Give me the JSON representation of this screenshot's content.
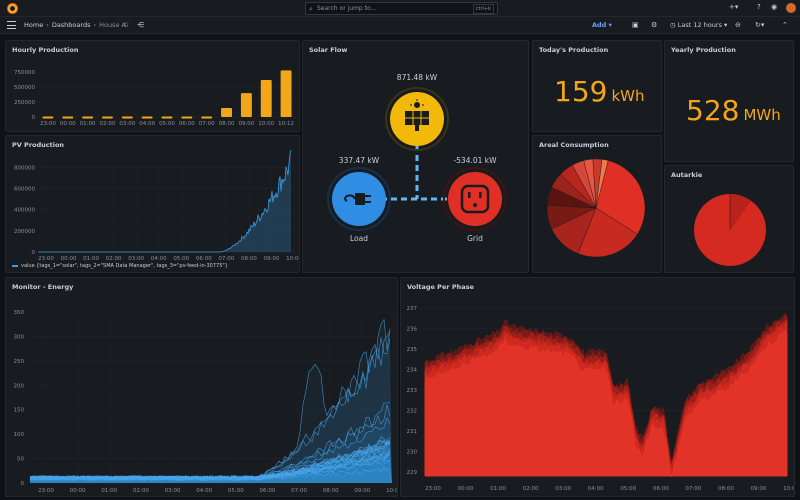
{
  "topbar": {
    "search_placeholder": "Search or jump to...",
    "search_shortcut": "ctrl+k",
    "plus_icon": "plus-icon",
    "news_icon": "rss-icon"
  },
  "nav": {
    "breadcrumb": [
      "Home",
      "Dashboards",
      "House A"
    ],
    "add_label": "Add",
    "time_range": "Last 12 hours"
  },
  "colors": {
    "accent": "#f2a71b",
    "blue": "#3d9be3",
    "red": "#e02f25",
    "panel_bg": "#181b1f"
  },
  "panels": {
    "hourly": {
      "title": "Hourly Production",
      "y_ticks": [
        "750000",
        "500000",
        "250000",
        "0"
      ],
      "x_ticks": [
        "23:00",
        "00:00",
        "01:00",
        "02:00",
        "03:00",
        "04:00",
        "05:00",
        "06:00",
        "07:00",
        "08:00",
        "09:00",
        "10:00",
        "10:12"
      ],
      "values": [
        8000,
        8000,
        8000,
        8000,
        8000,
        8000,
        8000,
        8000,
        8000,
        150000,
        400000,
        620000,
        780000
      ]
    },
    "pv": {
      "title": "PV Production",
      "y_ticks": [
        "800000",
        "600000",
        "400000",
        "200000",
        "0"
      ],
      "x_ticks": [
        "23:00",
        "00:00",
        "01:00",
        "02:00",
        "03:00",
        "04:00",
        "05:00",
        "06:00",
        "07:00",
        "08:00",
        "09:00",
        "10:00"
      ],
      "legend": "value {tags_1=\"solar\", tags_2=\"SMA Data Manager\", tags_3=\"pv-feed-in-30775\"}"
    },
    "solar_flow": {
      "title": "Solar Flow",
      "solar_value": "871.48 kW",
      "load_value": "337.47 kW",
      "grid_value": "-534.01 kW",
      "load_label": "Load",
      "grid_label": "Grid"
    },
    "today": {
      "title": "Today's Production",
      "value": "159",
      "unit": "kWh"
    },
    "yearly": {
      "title": "Yearly Production",
      "value": "528",
      "unit": "MWh"
    },
    "areal": {
      "title": "Areal Consumption"
    },
    "autarkie": {
      "title": "Autarkie"
    },
    "monitor": {
      "title": "Monitor - Energy",
      "y_ticks": [
        "350",
        "300",
        "250",
        "200",
        "150",
        "100",
        "50",
        "0"
      ],
      "x_ticks": [
        "23:00",
        "00:00",
        "01:00",
        "02:00",
        "03:00",
        "04:00",
        "05:00",
        "06:00",
        "07:00",
        "08:00",
        "09:00",
        "10:00"
      ]
    },
    "voltage": {
      "title": "Voltage Per Phase",
      "y_ticks": [
        "237",
        "236",
        "235",
        "234",
        "233",
        "232",
        "231",
        "230",
        "229"
      ],
      "x_ticks": [
        "23:00",
        "00:00",
        "01:00",
        "02:00",
        "03:00",
        "04:00",
        "05:00",
        "06:00",
        "07:00",
        "08:00",
        "09:00",
        "10:00"
      ]
    }
  }
}
